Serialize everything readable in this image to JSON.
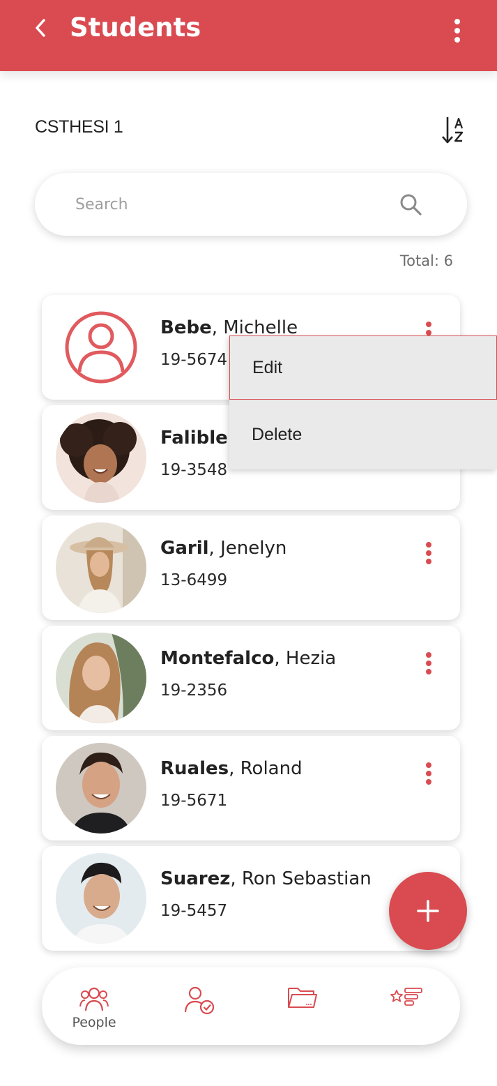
{
  "app_bar": {
    "title": "Students",
    "back_icon": "chevron-left-icon",
    "menu_icon": "more-vert-icon"
  },
  "class_section": {
    "name": "CSTHESI 1",
    "sort_icon": "sort-alpha-down-icon"
  },
  "search": {
    "placeholder": "Search",
    "value": "",
    "icon": "search-icon"
  },
  "total_label": "Total: 6",
  "students": [
    {
      "last": "Bebe",
      "first": "Michelle",
      "id": "19-5674",
      "avatar": "default-person-icon"
    },
    {
      "last": "Falible",
      "first": "",
      "id": "19-3548",
      "avatar": "photo"
    },
    {
      "last": "Garil",
      "first": "Jenelyn",
      "id": "13-6499",
      "avatar": "photo"
    },
    {
      "last": "Montefalco",
      "first": "Hezia",
      "id": "19-2356",
      "avatar": "photo"
    },
    {
      "last": "Ruales",
      "first": "Roland",
      "id": "19-5671",
      "avatar": "photo"
    },
    {
      "last": "Suarez",
      "first": "Ron Sebastian",
      "id": "19-5457",
      "avatar": "photo"
    }
  ],
  "context_menu": {
    "edit_label": "Edit",
    "delete_label": "Delete"
  },
  "fab": {
    "icon": "plus-icon"
  },
  "bottom_nav": {
    "items": [
      {
        "label": "People",
        "icon": "people-icon",
        "active": true
      },
      {
        "label": "",
        "icon": "person-check-icon",
        "active": false
      },
      {
        "label": "",
        "icon": "folder-icon",
        "active": false
      },
      {
        "label": "",
        "icon": "star-list-icon",
        "active": false
      }
    ]
  },
  "colors": {
    "accent": "#d94b50",
    "menu_bg": "#ebeaea"
  }
}
